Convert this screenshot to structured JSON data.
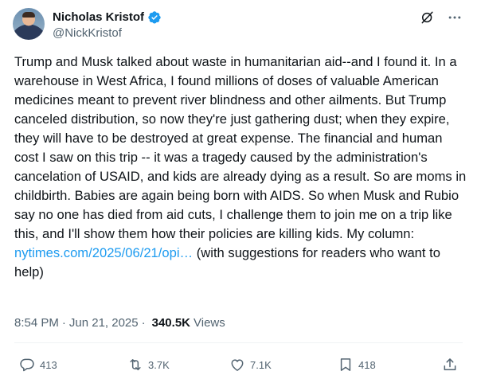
{
  "author": {
    "display_name": "Nicholas Kristof",
    "handle": "@NickKristof",
    "verified": true
  },
  "tweet": {
    "text_before_link": "Trump and Musk talked about waste in humanitarian aid--and I found it. In a warehouse in West Africa, I found millions of doses of valuable American medicines meant to prevent river blindness and other ailments. But  Trump canceled distribution, so now they're just gathering dust; when they expire, they will have to be destroyed at great expense. The financial and human cost I saw on this trip -- it was a tragedy caused by the administration's cancelation of USAID, and kids are already dying as a result. So are moms in childbirth. Babies are again being born with AIDS. So when Musk and Rubio say no one has died from aid cuts, I challenge them to join me on a trip like this, and I'll show them how their policies are killing kids. My column: ",
    "link_text": "nytimes.com/2025/06/21/opi…",
    "text_after_link": " (with suggestions for readers who want to help)"
  },
  "meta": {
    "time": "8:54 PM",
    "dot1": "·",
    "date": "Jun 21, 2025",
    "dot2": "·",
    "views_count": "340.5K",
    "views_label": "Views"
  },
  "actions": {
    "replies": "413",
    "reposts": "3.7K",
    "likes": "7.1K",
    "bookmarks": "418"
  },
  "icons": {
    "verified": "verified-badge-icon",
    "grok": "grok-icon",
    "more": "more-icon",
    "reply": "reply-icon",
    "repost": "repost-icon",
    "like": "heart-icon",
    "bookmark": "bookmark-icon",
    "share": "share-icon"
  },
  "colors": {
    "text": "#0f1419",
    "secondary": "#536471",
    "link": "#1d9bf0",
    "verified": "#1d9bf0"
  }
}
